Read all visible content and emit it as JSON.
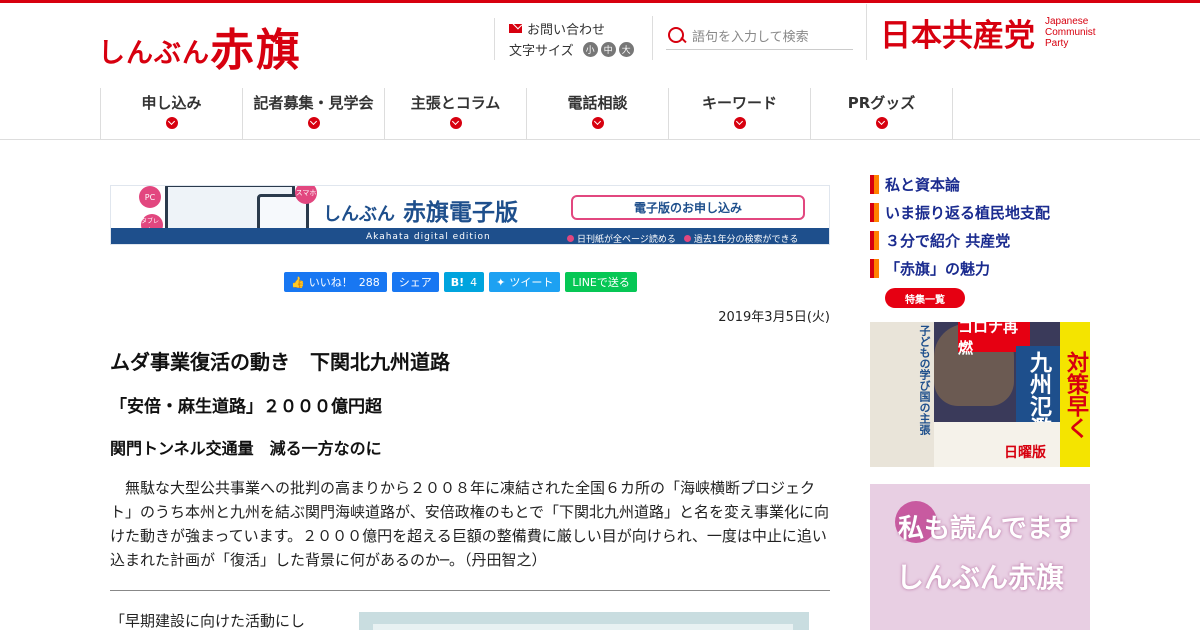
{
  "header": {
    "logo_small": "しんぶん",
    "logo_big": "赤旗",
    "contact_label": "お問い合わせ",
    "font_size_label": "文字サイズ",
    "font_sizes": [
      "小",
      "中",
      "大"
    ],
    "search_placeholder": "語句を入力して検索",
    "party_name": "日本共産党",
    "party_en_1": "Japanese",
    "party_en_2": "Communist",
    "party_en_3": "Party"
  },
  "nav": {
    "items": [
      "申し込み",
      "記者募集・見学会",
      "主張とコラム",
      "電話相談",
      "キーワード",
      "PRグッズ"
    ]
  },
  "banner": {
    "pc_badge": "PC",
    "tablet_badge": "タブレット",
    "phone_badge": "スマホ",
    "title_small": "しんぶん",
    "title_big": "赤旗電子版",
    "subtitle": "Akahata digital edition",
    "apply_label": "電子版のお申し込み",
    "note1": "日刊紙が全ページ読める",
    "note2": "過去1年分の検索ができる"
  },
  "share": {
    "like_label": "いいね！",
    "like_count": "288",
    "share_label": "シェア",
    "hatena_label": "B!",
    "hatena_count": "4",
    "tweet_label": "ツイート",
    "line_label": "LINEで送る"
  },
  "article": {
    "date": "2019年3月5日(火)",
    "title": "ムダ事業復活の動き　下関北九州道路",
    "subtitle": "「安倍・麻生道路」２０００億円超",
    "heading": "関門トンネル交通量　減る一方なのに",
    "lead": "　無駄な大型公共事業への批判の高まりから２００８年に凍結された全国６カ所の「海峡横断プロジェクト」のうち本州と九州を結ぶ関門海峡道路が、安倍政権のもとで「下関北九州道路」と名を変え事業化に向けた動きが強まっています。２０００億円を超える巨額の整備費に厳しい目が向けられ、一度は中止に追い込まれた計画が「復活」した背景に何があるのか─。（丹田智之）",
    "body_start": "「早期建設に向けた活動にし"
  },
  "sidebar": {
    "links": [
      "私と資本論",
      "いま振り返る植民地支配",
      "３分で紹介 共産党",
      "「赤旗」の魅力"
    ],
    "more_label": "特集一覧",
    "ad1_red": "コロナ再燃",
    "ad1_blue": "九州氾濫",
    "ad1_right": "対策早く",
    "ad1_left": "子どもの学び国の主張",
    "ad1_sun": "日曜版",
    "ad2_line1": "私も読んでます",
    "ad2_line2": "しんぶん赤旗"
  }
}
